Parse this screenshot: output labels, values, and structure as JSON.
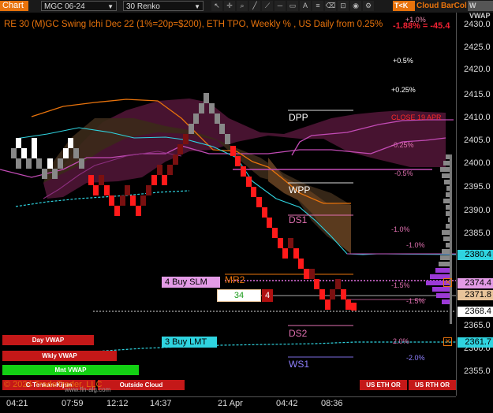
{
  "toolbar": {
    "chart_label": "Chart",
    "symbol": "MGC 06-24",
    "bar_type": "30 Renko",
    "tk_label": "T<K",
    "cloud_label": "Cloud",
    "barcol_label": "BarCol",
    "vwap_label": "W VWAP"
  },
  "header": {
    "title": "RE 30 (M)GC Swing Ichi Dec 22 (1%=20p=$200), ETH TPO, Weekly % , US Daily from 0.25%",
    "change": "-1.88% = -45.4",
    "top_pct": "+1.0%"
  },
  "price_axis": {
    "ticks": [
      "2430.0",
      "2425.0",
      "2420.0",
      "2415.0",
      "2410.0",
      "2405.0",
      "2400.0",
      "2395.0",
      "2390.0",
      "2385.0",
      "2380.0",
      "2375.0",
      "2370.0",
      "2365.0",
      "2360.0",
      "2355.0"
    ],
    "labels": {
      "cyan_high": "2380.4",
      "buy_slm": "2374.4",
      "tan": "2371.8",
      "white": "2368.4",
      "cyan_low": "2361.7"
    }
  },
  "time_axis": [
    "04:21",
    "07:59",
    "12:12",
    "14:37",
    "21 Apr",
    "04:42",
    "08:36"
  ],
  "levels": {
    "dpp": "DPP",
    "wpp": "WPP",
    "ds1": "DS1",
    "mr2": "MR2",
    "ds2": "DS2",
    "ws1": "WS1",
    "close_label": "CLOSE 19 APR"
  },
  "percent_labels": {
    "p05": "+0.5%",
    "p025": "+0.25%",
    "m025": "-0.25%",
    "m05": "-0.5%",
    "m10": "-1.0%",
    "m10b": "-1.0%",
    "m15": "-1.5%",
    "m15b": "-1.5%",
    "m20": "2.0%",
    "m20b": "-2.0%"
  },
  "orders": {
    "buy_slm": "4 Buy SLM",
    "buy_lmt": "3 Buy LMT",
    "qty_field": "34",
    "qty_count": "4"
  },
  "bottom_buttons": {
    "day_vwap": "Day VWAP",
    "wkly_vwap": "Wkly VWAP",
    "mnt_vwap": "Mnt VWAP",
    "ctenkan": "C-Tenkan-Kijun",
    "outside_cloud": "Outside Cloud",
    "us_eth_or": "US ETH OR",
    "us_rth_or": "US RTH OR"
  },
  "footer": {
    "copyright": "© 2024 TradeTrader, LLC",
    "url": "www.fin-alg.com"
  },
  "colors": {
    "orange": "#e8730c",
    "cyan": "#2fd4e0",
    "magenta": "#c24bb5",
    "red": "#ff1a1a",
    "bg": "#000000"
  }
}
